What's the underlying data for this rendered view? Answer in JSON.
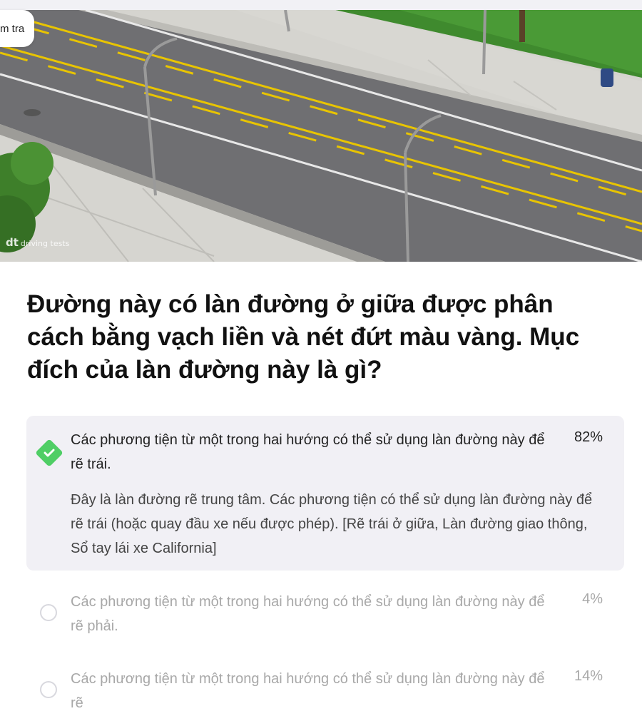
{
  "header": {
    "test_label": "m tra",
    "watermark": "driving tests",
    "watermark_logo": "dt"
  },
  "question": {
    "text": "Đường này có làn đường ở giữa được phân cách bằng vạch liền và nét đứt màu vàng. Mục đích của làn đường này là gì?"
  },
  "answers": [
    {
      "text": "Các phương tiện từ một trong hai hướng có thể sử dụng làn đường này để rẽ trái.",
      "percent": "82%",
      "state": "correct",
      "explanation": "Đây là làn đường rẽ trung tâm. Các phương tiện có thể sử dụng làn đường này để rẽ trái (hoặc quay đầu xe nếu được phép). [Rẽ trái ở giữa, Làn đường giao thông, Sổ tay lái xe California]"
    },
    {
      "text": "Các phương tiện từ một trong hai hướng có thể sử dụng làn đường này để rẽ phải.",
      "percent": "4%",
      "state": "unselected"
    },
    {
      "text": "Các phương tiện từ một trong hai hướng có thể sử dụng làn đường này để rẽ",
      "percent": "14%",
      "state": "unselected"
    }
  ],
  "colors": {
    "correct": "#4fce65",
    "selected_bg": "#f1f0f5",
    "road": "#6f6f72",
    "yellow_line": "#e8c400"
  }
}
